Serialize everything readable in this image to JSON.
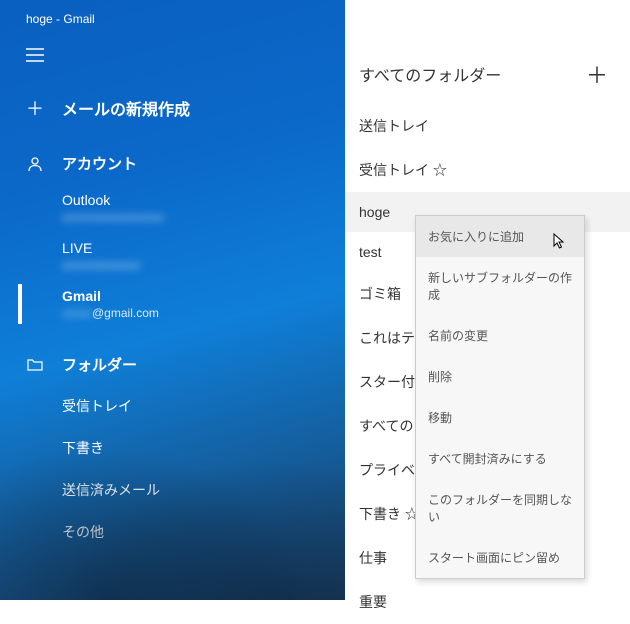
{
  "window": {
    "title": "hoge - Gmail"
  },
  "sidebar": {
    "newmail_label": "メールの新規作成",
    "accounts_label": "アカウント",
    "accounts": [
      {
        "name": "Outlook",
        "sub": ""
      },
      {
        "name": "LIVE",
        "sub": ""
      },
      {
        "name": "Gmail",
        "sub": "@gmail.com"
      }
    ],
    "folders_label": "フォルダー",
    "folders": [
      "受信トレイ",
      "下書き",
      "送信済みメール",
      "その他"
    ]
  },
  "content": {
    "header": "すべてのフォルダー",
    "folders": [
      "送信トレイ",
      "受信トレイ ☆",
      "hoge",
      "test",
      "ゴミ箱",
      "これはテス",
      "スター付き",
      "すべてのメ",
      "プライベー",
      "下書き ☆",
      "仕事",
      "重要"
    ]
  },
  "context_menu": {
    "items": [
      "お気に入りに追加",
      "新しいサブフォルダーの作成",
      "名前の変更",
      "削除",
      "移動",
      "すべて開封済みにする",
      "このフォルダーを同期しない",
      "スタート画面にピン留め"
    ]
  }
}
